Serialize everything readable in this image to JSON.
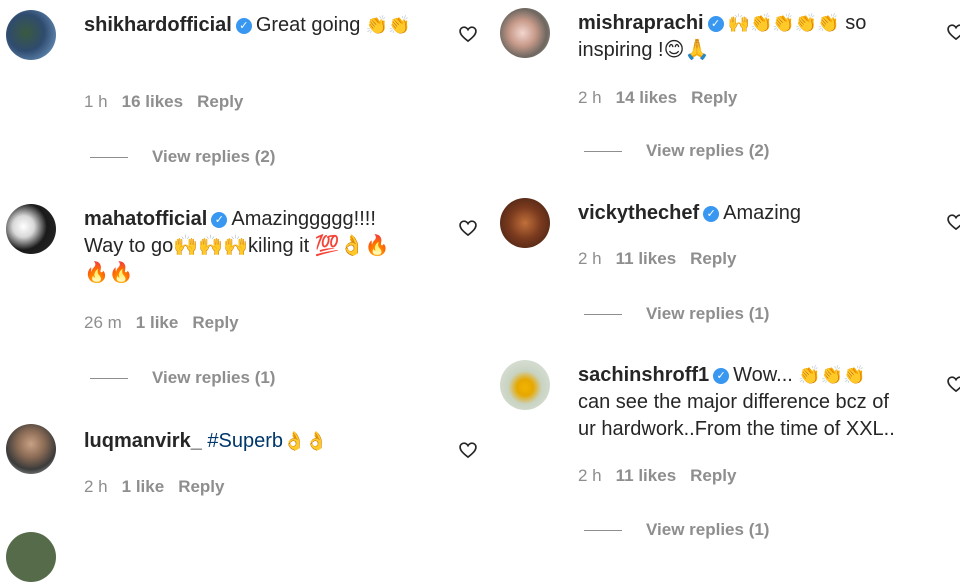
{
  "comments_left": [
    {
      "username": "shikhardofficial",
      "verified": true,
      "text": "Great going",
      "emojis": "👏👏",
      "time": "1 h",
      "likes": "16 likes",
      "reply": "Reply",
      "view_replies": "View replies (2)"
    },
    {
      "username": "mahatofficial",
      "verified": true,
      "text_line1": "Amazinggggg!!!!",
      "text_line2": "Way to go🙌🙌🙌kiling it 💯👌🔥",
      "text_line3": "🔥🔥",
      "time": "26 m",
      "likes": "1 like",
      "reply": "Reply",
      "view_replies": "View replies (1)"
    },
    {
      "username": "luqmanvirk_",
      "verified": false,
      "hashtag": "#Superb",
      "emojis": "👌👌",
      "time": "2 h",
      "likes": "1 like",
      "reply": "Reply"
    }
  ],
  "comments_right": [
    {
      "username": "mishraprachi",
      "verified": true,
      "emojis": "🙌👏👏👏👏",
      "text_line1_end": "so",
      "text_line2": "inspiring !😊🙏",
      "time": "2 h",
      "likes": "14 likes",
      "reply": "Reply",
      "view_replies": "View replies (2)"
    },
    {
      "username": "vickythechef",
      "verified": true,
      "text": "Amazing",
      "time": "2 h",
      "likes": "11 likes",
      "reply": "Reply",
      "view_replies": "View replies (1)"
    },
    {
      "username": "sachinshroff1",
      "verified": true,
      "text_line1": "Wow...",
      "emojis": "👏👏👏",
      "text_line2": "can see the major difference bcz of",
      "text_line3": "ur hardwork..From the time of XXL..",
      "time": "2 h",
      "likes": "11 likes",
      "reply": "Reply",
      "view_replies": "View replies (1)"
    }
  ],
  "colors": {
    "text": "#262626",
    "muted": "#8e8e8e",
    "verified": "#3897f0",
    "hashtag": "#00376b"
  }
}
